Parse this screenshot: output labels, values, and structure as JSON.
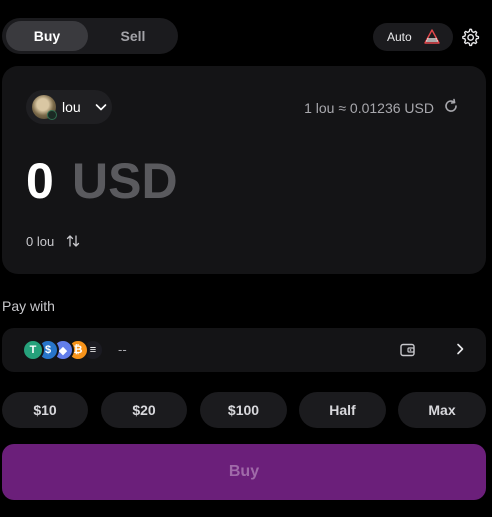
{
  "tabs": {
    "buy": "Buy",
    "sell": "Sell"
  },
  "auto_button": {
    "label": "Auto",
    "warn_color": "#e5484d"
  },
  "token": {
    "name": "lou"
  },
  "rate": {
    "text": "1 lou ≈ 0.01236 USD"
  },
  "amount": {
    "value": "0",
    "unit": "USD"
  },
  "sub_amount": {
    "text": "0 lou"
  },
  "pay_with": {
    "label": "Pay with",
    "value": "--",
    "coins": [
      {
        "symbol": "T",
        "name": "tether-icon",
        "color": "#26a17b"
      },
      {
        "symbol": "$",
        "name": "usdc-icon",
        "color": "#2775ca"
      },
      {
        "symbol": "◆",
        "name": "ethereum-icon",
        "color": "#627eea"
      },
      {
        "symbol": "₿",
        "name": "bitcoin-icon",
        "color": "#f7931a"
      },
      {
        "symbol": "≡",
        "name": "solana-icon",
        "color": "#1b1b22"
      }
    ]
  },
  "quick_amounts": [
    "$10",
    "$20",
    "$100",
    "Half",
    "Max"
  ],
  "buy_button": {
    "label": "Buy",
    "color": "#6b1f7a"
  }
}
